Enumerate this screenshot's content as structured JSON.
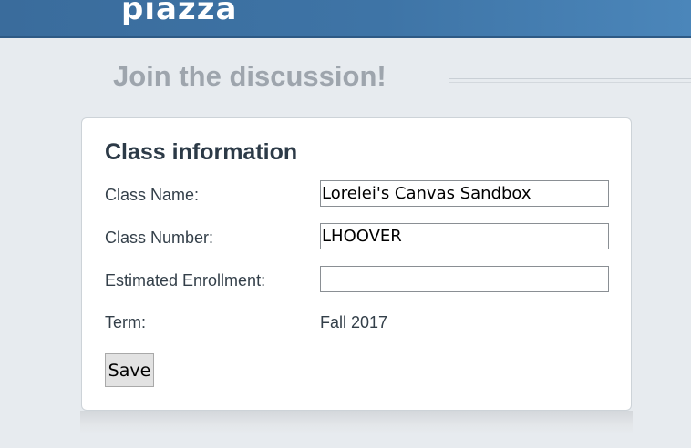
{
  "header": {
    "logo_text": "piazza"
  },
  "heading": "Join the discussion!",
  "class_info": {
    "title": "Class information",
    "fields": [
      {
        "label": "Class Name:",
        "value": "Lorelei's Canvas Sandbox"
      },
      {
        "label": "Class Number:",
        "value": "LHOOVER"
      },
      {
        "label": "Estimated Enrollment:",
        "value": ""
      }
    ],
    "term": {
      "label": "Term:",
      "value": "Fall 2017"
    },
    "save_label": "Save"
  },
  "colors": {
    "header_bar": "#3e74a6",
    "page_background": "#e7ebef",
    "heading_text": "#9ea5ad"
  }
}
